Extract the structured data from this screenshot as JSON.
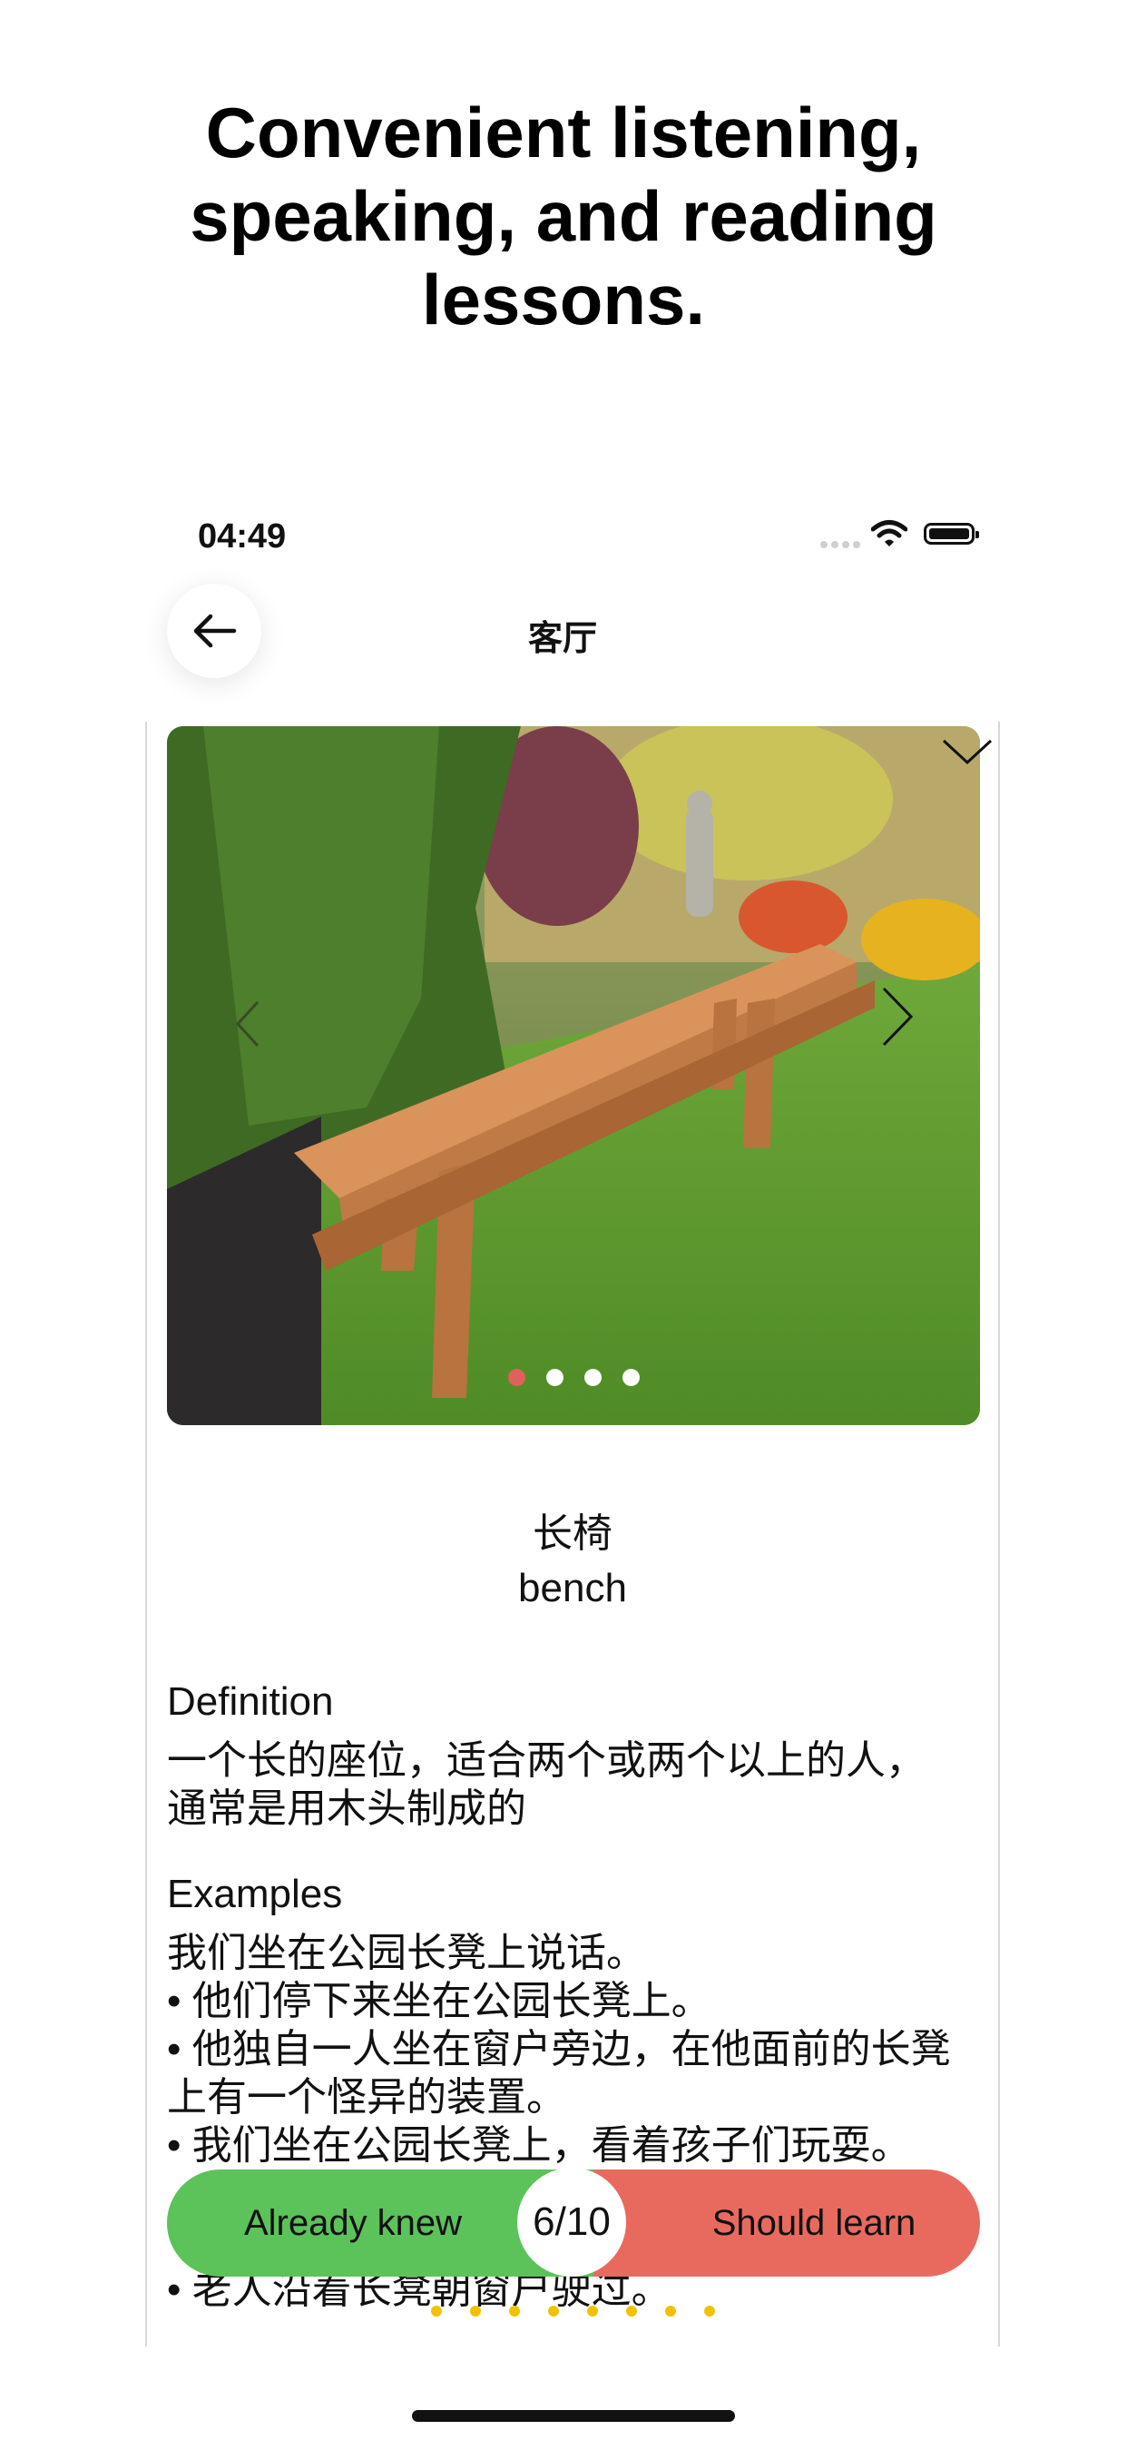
{
  "promo": {
    "headline": "Convenient listening,\nspeaking, and reading\nlessons."
  },
  "status_bar": {
    "time": "04:49"
  },
  "nav": {
    "title": "客厅"
  },
  "card": {
    "image_dots": {
      "count": 4,
      "active_index": 0
    },
    "word": {
      "chinese": "长椅",
      "english": "bench"
    },
    "definition": {
      "title": "Definition",
      "text": "一个长的座位，适合两个或两个以上的人，通常是用木头制成的"
    },
    "examples": {
      "title": "Examples",
      "items": [
        "我们坐在公园长凳上说话。",
        "• 他们停下来坐在公园长凳上。",
        "• 他独自一人坐在窗户旁边，在他面前的长凳上有一个怪异的装置。",
        "• 我们坐在公园长凳上，看着孩子们玩耍。",
        "• 老人沿着长凳朝窗户驶过。"
      ]
    }
  },
  "actions": {
    "knew_label": "Already knew",
    "learn_label": "Should learn",
    "counter": "6/10"
  },
  "progress_dots": {
    "count": 8
  },
  "colors": {
    "knew": "#5cc25a",
    "learn": "#e86a5e",
    "active_dot": "#e0615b",
    "progress_dot": "#f2c200"
  }
}
